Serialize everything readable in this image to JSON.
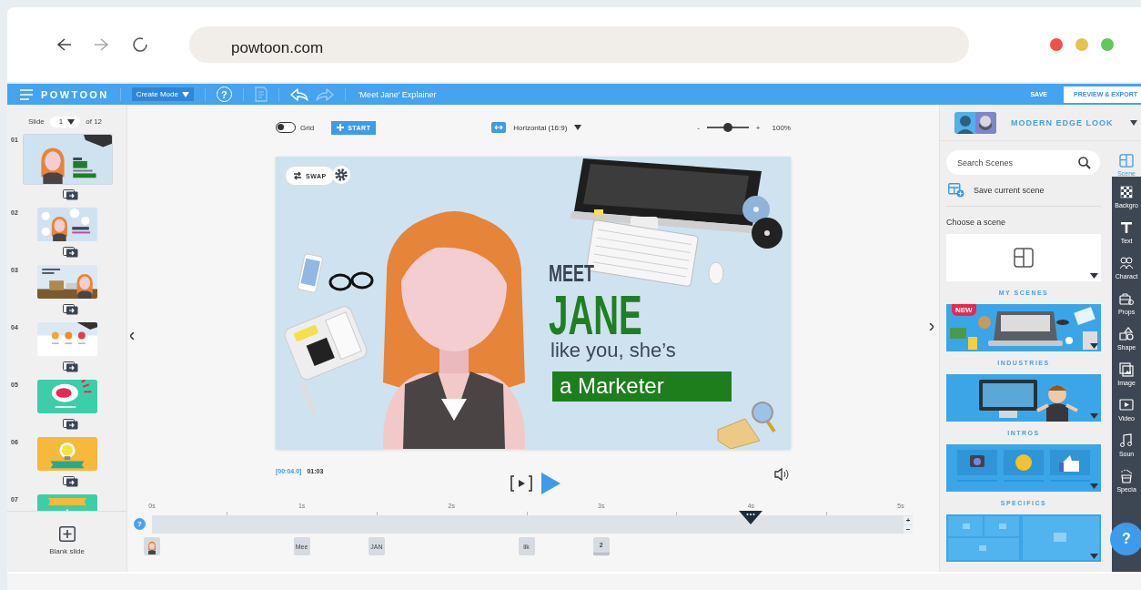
{
  "browser": {
    "url": "powtoon.com",
    "back_disabled": false,
    "forward_disabled": true,
    "window_controls": [
      {
        "color": "#f0504a"
      },
      {
        "color": "#e2c34c"
      },
      {
        "color": "#62c85a"
      }
    ]
  },
  "app_bar": {
    "logo": "POWTOON",
    "mode": "Create Mode",
    "help": "?",
    "notes_disabled": true,
    "undo_disabled": false,
    "redo_disabled": true,
    "title": "'Meet Jane' Explainer",
    "save": "SAVE",
    "preview": "PREVIEW & EXPORT"
  },
  "slides_panel": {
    "label": "Slide",
    "current": "1",
    "total": "of 12",
    "slides": [
      {
        "number": "01",
        "kind": "jane",
        "selected": true
      },
      {
        "number": "02",
        "kind": "questions",
        "selected": false
      },
      {
        "number": "03",
        "kind": "office",
        "selected": false
      },
      {
        "number": "04",
        "kind": "abc",
        "selected": false
      },
      {
        "number": "05",
        "kind": "ohno",
        "selected": false
      },
      {
        "number": "06",
        "kind": "idea",
        "selected": false
      },
      {
        "number": "07",
        "kind": "banner",
        "selected": false
      }
    ],
    "blank_slide": "Blank slide"
  },
  "canvas_toolbar": {
    "grid": {
      "label": "Grid",
      "on": false
    },
    "start": "START",
    "orientation": "Horizontal (16:9)",
    "zoom": {
      "minus": "-",
      "plus": "+",
      "level": 0.5,
      "reading": "100%"
    }
  },
  "stage": {
    "swap": "SWAP",
    "texts": [
      {
        "kind": "heading",
        "text": "MEET"
      },
      {
        "kind": "title",
        "text": "JANE"
      },
      {
        "kind": "subtitle",
        "text": "like you, she’s"
      },
      {
        "kind": "banner",
        "text": "a Marketer"
      }
    ]
  },
  "playback": {
    "current_time": "[00:04.0]",
    "total_time": "01:03"
  },
  "timeline": {
    "help": "?",
    "ticks": [
      "0s",
      "1s",
      "2s",
      "3s",
      "4s",
      "5s"
    ],
    "playhead": {
      "level": 0.8
    },
    "zoom_in": "+",
    "zoom_out": "−",
    "markers": [
      {
        "kind": "character"
      },
      {
        "kind": "text",
        "label": "Mee"
      },
      {
        "kind": "text",
        "label": "JAN"
      },
      {
        "kind": "text",
        "label": "lik"
      },
      {
        "kind": "stack",
        "label": "2"
      }
    ]
  },
  "right_panel": {
    "look": "MODERN EDGE LOOK",
    "search": {
      "placeholder": "Search Scenes"
    },
    "save_scene": "Save current scene",
    "choose_label": "Choose a scene",
    "categories": [
      {
        "kind": "my",
        "label": "MY SCENES"
      },
      {
        "kind": "industries",
        "label": "INDUSTRIES",
        "badge": "NEW"
      },
      {
        "kind": "intros",
        "label": "INTROS"
      },
      {
        "kind": "specifics",
        "label": "SPECIFICS"
      },
      {
        "kind": "templates"
      }
    ]
  },
  "tools": [
    {
      "kind": "scenes",
      "label": "Scene",
      "selected": true
    },
    {
      "kind": "background",
      "label": "Backgro",
      "selected": false
    },
    {
      "kind": "text",
      "label": "Text",
      "selected": false
    },
    {
      "kind": "characters",
      "label": "Charact",
      "selected": false
    },
    {
      "kind": "props",
      "label": "Props",
      "selected": false
    },
    {
      "kind": "shapes",
      "label": "Shape",
      "selected": false
    },
    {
      "kind": "images",
      "label": "Image",
      "selected": false
    },
    {
      "kind": "video",
      "label": "Video",
      "selected": false
    },
    {
      "kind": "sound",
      "label": "Soun",
      "selected": false
    },
    {
      "kind": "special",
      "label": "Specia",
      "selected": false
    }
  ],
  "help_button": "?"
}
